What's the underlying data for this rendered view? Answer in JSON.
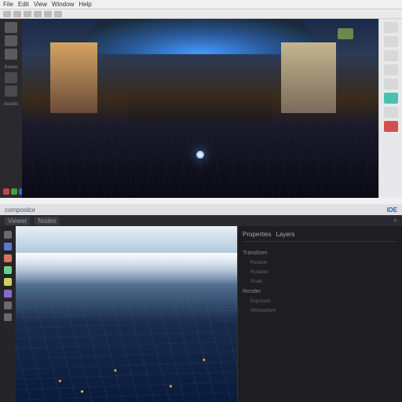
{
  "top_app": {
    "menu": [
      "File",
      "Edit",
      "View",
      "Window",
      "Help"
    ],
    "sidebar": {
      "label_1": "Scene",
      "label_2": "Assets"
    },
    "palette": [
      "#d04040",
      "#40a040",
      "#4060d0",
      "#d0a040",
      "#a040d0",
      "#40c0c0",
      "#d0d0d0"
    ],
    "right_tools": [
      {
        "name": "selection-icon"
      },
      {
        "name": "layers-icon"
      },
      {
        "name": "transform-icon"
      },
      {
        "name": "material-icon"
      },
      {
        "name": "render-icon"
      },
      {
        "name": "link-icon"
      },
      {
        "name": "export-icon"
      },
      {
        "name": "record-icon"
      }
    ]
  },
  "bottom_app": {
    "title": "compositor",
    "title_right": "IDE",
    "tabs": [
      "Viewer",
      "Nodes"
    ],
    "search_placeholder": "search",
    "sidebar_colors": [
      "#6a6a70",
      "#5a7ad0",
      "#d07a5a",
      "#6ad08a",
      "#d0d06a",
      "#8a6ad0",
      "#6a6a70",
      "#6a6a70"
    ],
    "inspector": {
      "tabs": [
        "Properties",
        "Layers"
      ],
      "rows": [
        {
          "label": "Transform"
        },
        {
          "label": "Position",
          "sub": true
        },
        {
          "label": "Rotation",
          "sub": true
        },
        {
          "label": "Scale",
          "sub": true
        },
        {
          "label": "Render"
        },
        {
          "label": "Exposure",
          "sub": true
        },
        {
          "label": "Atmosphere",
          "sub": true
        }
      ]
    }
  }
}
